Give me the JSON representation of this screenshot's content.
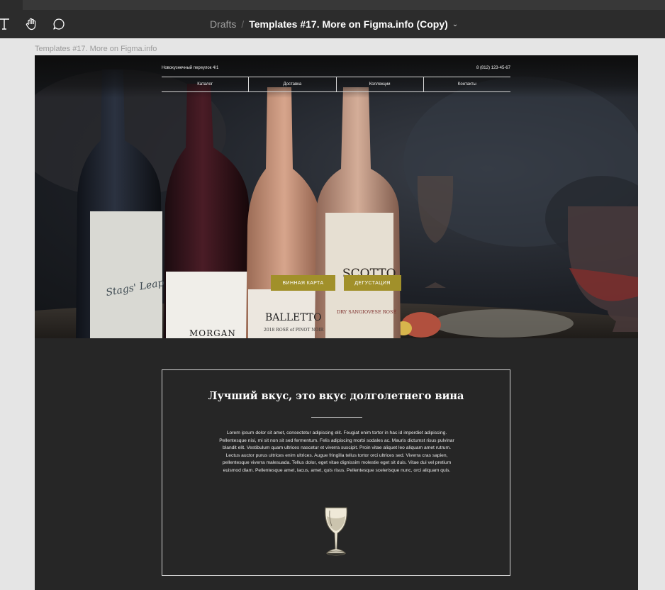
{
  "toolbar": {
    "tools": [
      "text-tool",
      "hand-tool",
      "comment-tool"
    ],
    "breadcrumb_root": "Drafts",
    "separator": "/",
    "file_name": "Templates #17. More on Figma.info (Copy)",
    "chevron": "⌄"
  },
  "canvas": {
    "frame_label": "Templates #17. More on Figma.info",
    "background": "#e5e5e5"
  },
  "site": {
    "address": "Новокузнечный переулок 4/1",
    "phone": "8 (812) 123-45-67",
    "nav": [
      "Каталог",
      "Доставка",
      "Коллекции",
      "Контакты"
    ],
    "cta_wine_list": "ВИННАЯ КАРТА",
    "cta_tasting": "ДЕГУСТАЦИЯ",
    "accent_color": "#a1902a",
    "bottle_labels": {
      "left": "Stags' Leap",
      "morgan": "MORGAN",
      "balletto": "BALLETTO",
      "balletto_sub": "2018 ROSÉ of PINOT NOIR",
      "scotto": "SCOTTO",
      "scotto_sub": "DRY SANGIOVESE ROSÉ"
    },
    "section_title": "Лучший вкус, это вкус долголетнего вина",
    "section_body": "Lorem ipsum dolor sit amet, consectetur adipiscing elit. Feugiat enim tortor in hac id imperdiet adipiscing. Pellentesque nisi, mi sit non sit sed fermentum. Felis adipiscing morbi sodales ac. Mauris dictumst risus pulvinar blandit elit. Vestibulum quam ultrices nascetur et viverra suscipit. Proin vitae aliquet leo aliquam amet rutrum. Lectus auctor purus ultrices enim ultrices. Augue fringilla tellus tortor orci ultrices sed. Viverra cras sapien, pellentesque viverra malesuada. Tellus dolor, eget vitae dignissim molestie eget sit duis. Vitae dui vel pretium euismod diam. Pellentesque amet, lacus, amet, quis risus. Pellentesque scelerisque nunc, orci aliquam quis.",
    "glass_icon": "wine-glass-illustration"
  }
}
